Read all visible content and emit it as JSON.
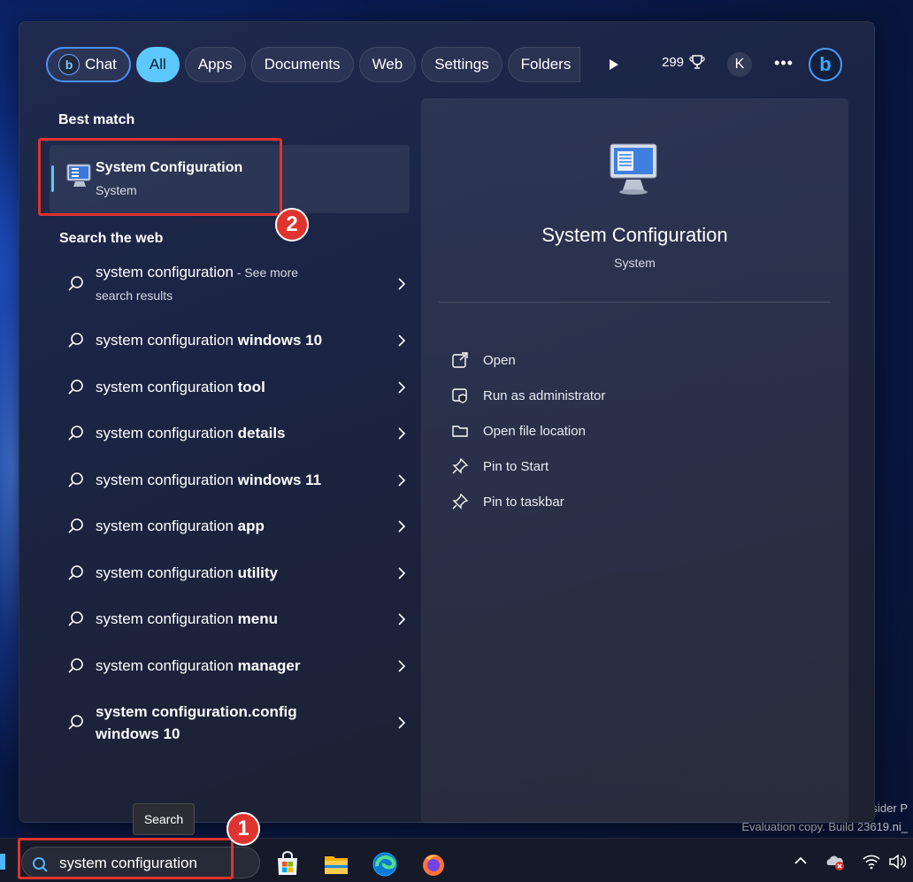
{
  "filters": {
    "chat": "Chat",
    "all": "All",
    "apps": "Apps",
    "documents": "Documents",
    "web": "Web",
    "settings": "Settings",
    "folders": "Folders"
  },
  "header": {
    "points": "299",
    "avatar_initial": "K",
    "more": "•••"
  },
  "best_match": {
    "heading": "Best match",
    "name": "System Configuration",
    "type": "System"
  },
  "web": {
    "heading": "Search the web",
    "items": [
      {
        "prefix": "system configuration",
        "bold": "",
        "suffix": " - See more",
        "line2": "search results"
      },
      {
        "prefix": "system configuration ",
        "bold": "windows 10"
      },
      {
        "prefix": "system configuration ",
        "bold": "tool"
      },
      {
        "prefix": "system configuration ",
        "bold": "details"
      },
      {
        "prefix": "system configuration ",
        "bold": "windows 11"
      },
      {
        "prefix": "system configuration ",
        "bold": "app"
      },
      {
        "prefix": "system configuration ",
        "bold": "utility"
      },
      {
        "prefix": "system configuration ",
        "bold": "menu"
      },
      {
        "prefix": "system configuration ",
        "bold": "manager"
      },
      {
        "prefix": "system configuration",
        "bold": ".config",
        "line2_bold": "windows 10"
      }
    ]
  },
  "preview": {
    "title": "System Configuration",
    "subtitle": "System",
    "actions": [
      "Open",
      "Run as administrator",
      "Open file location",
      "Pin to Start",
      "Pin to taskbar"
    ]
  },
  "tooltip": "Search",
  "taskbar": {
    "search_value": "system configuration"
  },
  "watermark": {
    "line1": "nsider P",
    "line2": "Evaluation copy. Build 23619.ni_"
  },
  "annotations": [
    "1",
    "2"
  ],
  "colors": {
    "accent": "#5cc8ff",
    "annotation": "#e0332f",
    "chat_border": "#4a90ff"
  }
}
